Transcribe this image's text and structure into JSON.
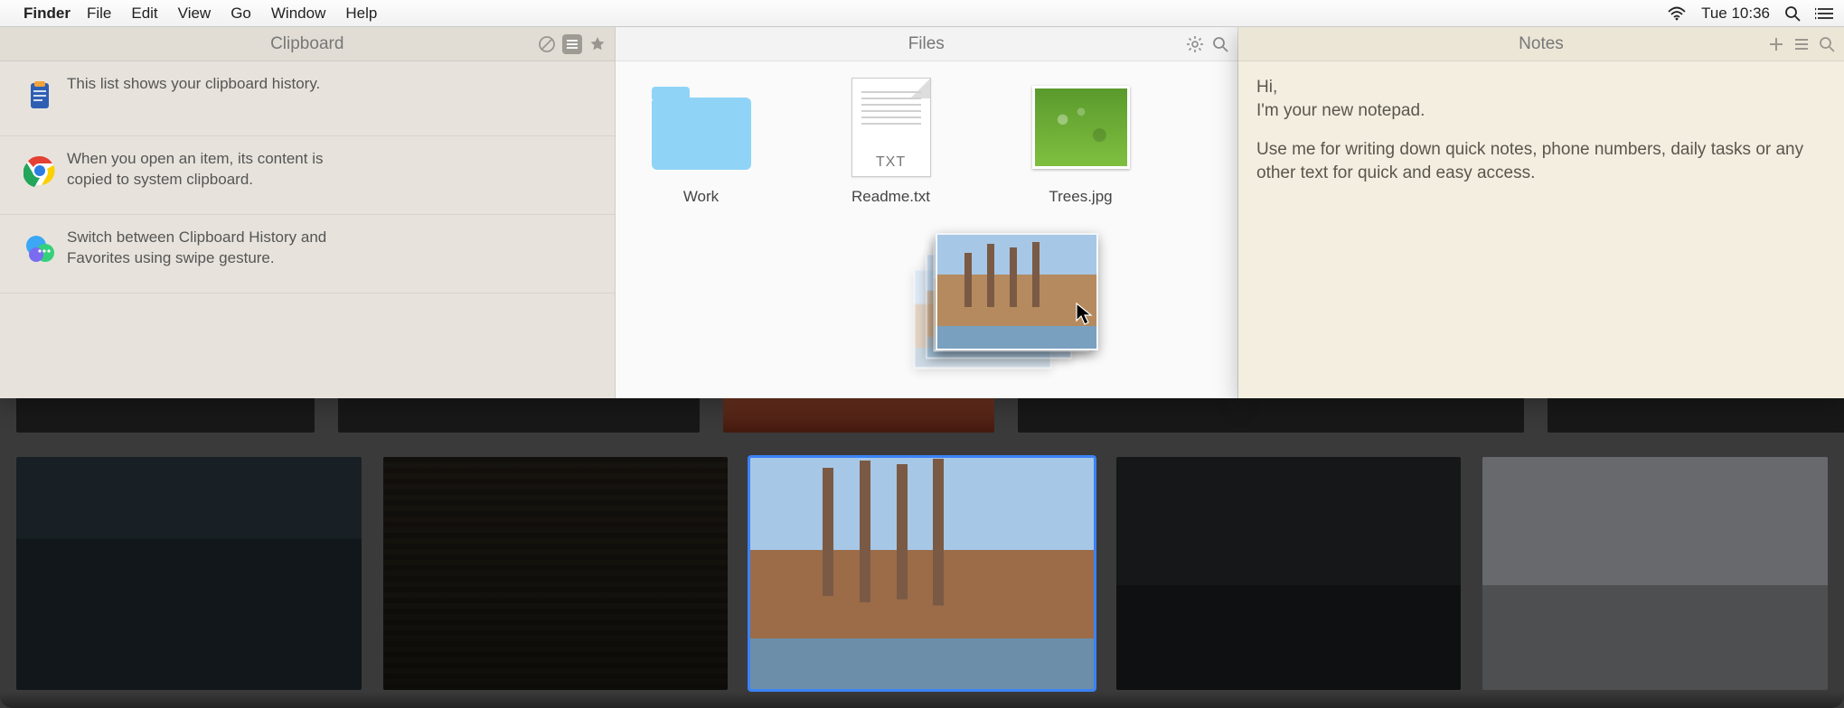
{
  "menubar": {
    "app": "Finder",
    "items": [
      "File",
      "Edit",
      "View",
      "Go",
      "Window",
      "Help"
    ],
    "clock": "Tue 10:36"
  },
  "clipboard": {
    "title": "Clipboard",
    "rows": [
      {
        "icon": "clipboard-icon",
        "text": "This list shows your clipboard history."
      },
      {
        "icon": "chrome-icon",
        "text": "When you open an item, its content is copied to system clipboard."
      },
      {
        "icon": "messages-icon",
        "text": "Switch between Clipboard History and Favorites using swipe gesture."
      }
    ]
  },
  "files": {
    "title": "Files",
    "items": [
      {
        "kind": "folder",
        "label": "Work"
      },
      {
        "kind": "txt",
        "ext": "TXT",
        "label": "Readme.txt"
      },
      {
        "kind": "image",
        "label": "Trees.jpg"
      }
    ]
  },
  "notes": {
    "title": "Notes",
    "line1": "Hi,",
    "line2": "I'm your new notepad.",
    "line3": "Use me for writing down quick notes, phone numbers, daily tasks or any other text for quick and easy access."
  }
}
